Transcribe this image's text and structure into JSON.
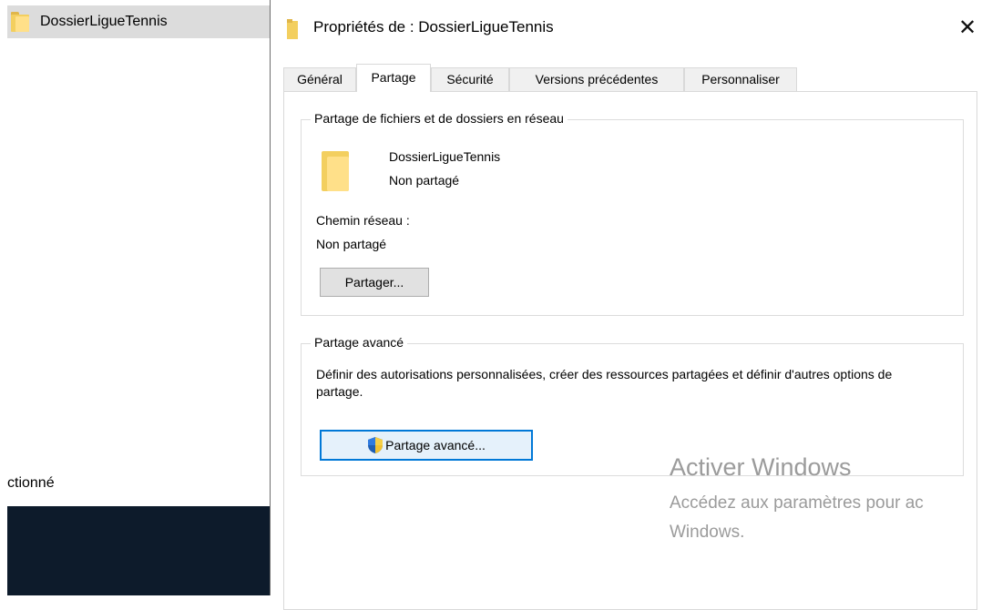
{
  "explorer": {
    "selected_item": "DossierLigueTennis",
    "status_text": "ctionné"
  },
  "dialog": {
    "title": "Propriétés de : DossierLigueTennis",
    "close_glyph": "✕",
    "tabs": [
      {
        "label": "Général"
      },
      {
        "label": "Partage"
      },
      {
        "label": "Sécurité"
      },
      {
        "label": "Versions précédentes"
      },
      {
        "label": "Personnaliser"
      }
    ],
    "active_tab": "Partage",
    "network_share": {
      "group_title": "Partage de fichiers et de dossiers en réseau",
      "folder_name": "DossierLigueTennis",
      "share_state": "Non partagé",
      "path_label": "Chemin réseau :",
      "path_value": "Non partagé",
      "share_button": "Partager..."
    },
    "advanced_share": {
      "group_title": "Partage avancé",
      "description": "Définir des autorisations personnalisées, créer des ressources partagées et définir d'autres options de partage.",
      "button": "Partage avancé..."
    }
  },
  "watermark": {
    "title": "Activer Windows",
    "line1": "Accédez aux paramètres pour ac",
    "line2": "Windows."
  },
  "colors": {
    "accent": "#0078d7",
    "folder": "#f3cf5f",
    "taskbar": "#0d1b2b"
  },
  "icons": [
    "folder-icon",
    "close-icon",
    "uac-shield-icon"
  ]
}
